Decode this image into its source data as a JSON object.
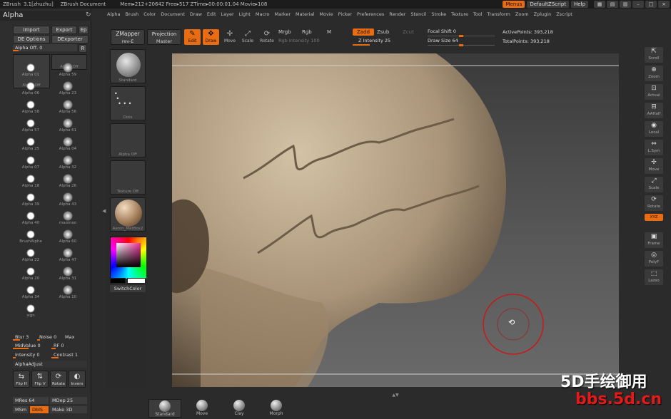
{
  "titlebar": {
    "app": "ZBrush",
    "version": "3.1[zhuzhu]",
    "document": "ZBrush Document",
    "mem": "Mem▸212+20642  Free▸517  ZTime▸00:00:01.04  Movie▸108",
    "menus_btn": "Menus",
    "script_btn": "DefaultZScript",
    "help_btn": "Help"
  },
  "menubar": [
    "Alpha",
    "Brush",
    "Color",
    "Document",
    "Draw",
    "Edit",
    "Layer",
    "Light",
    "Macro",
    "Marker",
    "Material",
    "Movie",
    "Picker",
    "Preferences",
    "Render",
    "Stencil",
    "Stroke",
    "Texture",
    "Tool",
    "Transform",
    "Zoom",
    "Zplugin",
    "Zscript"
  ],
  "leftpanel": {
    "title": "Alpha",
    "import": "Import",
    "export": "Export",
    "ep": "Ep",
    "de_options": "DE Options",
    "dexporter": "DExporter",
    "alpha_off_label": "Alpha Off. 0",
    "r_btn": "R",
    "current_alpha": "Alpha Off",
    "alphas": [
      "Alpha Off",
      "Alpha 01",
      "Alpha 59",
      "Alpha 06",
      "Alpha 23",
      "Alpha 58",
      "Alpha 56",
      "Alpha 57",
      "Alpha 61",
      "Alpha 25",
      "Alpha 04",
      "Alpha 07",
      "Alpha 32",
      "Alpha 18",
      "Alpha 26",
      "Alpha 39",
      "Alpha 43",
      "Alpha 40",
      "maomao",
      "BrushAlpha",
      "Alpha 60",
      "Alpha 22",
      "Alpha 47",
      "Alpha 20",
      "Alpha 31",
      "Alpha 34",
      "Alpha 10",
      "sign"
    ],
    "blur": "Blur 3",
    "noise": "Noise 0",
    "max": "Max",
    "midvalue": "MidValue 0",
    "rf": "RF 0",
    "intensity": "Intensity 0",
    "contrast": "Contrast 1",
    "alpha_adjust": "AlphaAdjust",
    "actions": [
      "Flip H",
      "Flip V",
      "Rotate",
      "Invers"
    ],
    "mres": "MRes 64",
    "mdep": "MDep 25",
    "msm": "MSm",
    "dbls": "DblS",
    "make3d": "Make 3D"
  },
  "toolbar": {
    "zmapper": "ZMapper",
    "zmapper_sub": "rev-E",
    "projection": "Projection",
    "projection_sub": "Master",
    "edit": "Edit",
    "draw": "Draw",
    "move": "Move",
    "scale": "Scale",
    "rotate": "Rotate",
    "mrgb": "Mrgb",
    "rgb": "Rgb",
    "m": "M",
    "rgb_intensity": "Rgb Intensity 100",
    "zadd": "Zadd",
    "zsub": "Zsub",
    "zcut": "Zcut",
    "z_intensity": "Z Intensity 25",
    "focal_shift": "Focal Shift 0",
    "draw_size": "Draw Size 64",
    "active_points": "ActivePoints: 393,218",
    "total_points": "TotalPoints: 393,218"
  },
  "tray": {
    "items": [
      "Standard",
      "Dots",
      "Alpha Off",
      "Texture Off",
      "Aaron_MatBox2"
    ],
    "switch_color": "SwitchColor"
  },
  "rightshelf": [
    "Scroll",
    "Zoom",
    "Actual",
    "AAHalf",
    "Local",
    "L.Sym",
    "Move",
    "Scale",
    "Rotate",
    "XYZ",
    "Frame",
    "PolyF",
    "Lazso"
  ],
  "bottombar": [
    "Standard",
    "Move",
    "Clay",
    "Morph"
  ],
  "watermark": {
    "line1": "5D手绘御用",
    "line2": "bbs.5d.cn"
  },
  "colors": {
    "accent": "#e96c12",
    "panel": "#2e2e2e",
    "skin": "#b39f85"
  }
}
